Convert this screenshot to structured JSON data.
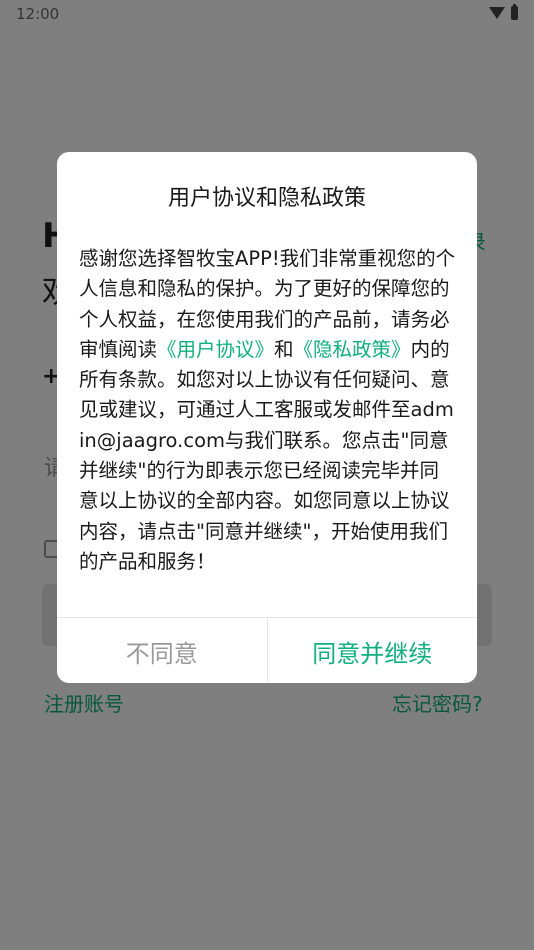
{
  "status_bar": {
    "time": "12:00"
  },
  "background": {
    "greeting": "H",
    "welcome": "欢",
    "sms_login_link": "录",
    "country_code": "+",
    "phone_placeholder": "请",
    "register_link": "注册账号",
    "forgot_password_link": "忘记密码?"
  },
  "dialog": {
    "title": "用户协议和隐私政策",
    "body_text_1": "感谢您选择智牧宝APP!我们非常重视您的个人信息和隐私的保护。为了更好的保障您的个人权益，在您使用我们的产品前，请务必审慎阅读",
    "user_agreement_link": "《用户协议》",
    "and_text": "和",
    "privacy_policy_link": "《隐私政策》",
    "body_text_2": "内的所有条款。如您对以上协议有任何疑问、意见或建议，可通过人工客服或发邮件至admin@jaagro.com与我们联系。您点击\"同意并继续\"的行为即表示您已经阅读完毕并同意以上协议的全部内容。如您同意以上协议内容，请点击\"同意并继续\"，开始使用我们的产品和服务！",
    "disagree_button": "不同意",
    "agree_button": "同意并继续"
  },
  "colors": {
    "accent": "#10b07c",
    "muted": "#999999"
  }
}
